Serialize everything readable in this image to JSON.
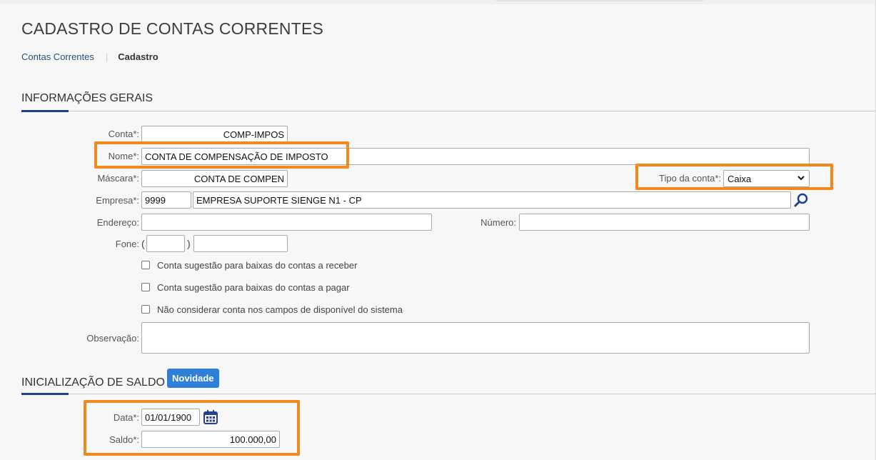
{
  "page": {
    "title": "CADASTRO DE CONTAS CORRENTES"
  },
  "breadcrumb": {
    "link": "Contas Correntes",
    "current": "Cadastro"
  },
  "sections": {
    "general": "INFORMAÇÕES GERAIS",
    "balance": "INICIALIZAÇÃO DE SALDO",
    "badge": "Novidade"
  },
  "form": {
    "conta": {
      "label": "Conta*:",
      "value": "COMP-IMPOS"
    },
    "nome": {
      "label": "Nome*:",
      "value": "CONTA DE COMPENSAÇÃO DE IMPOSTO"
    },
    "mascara": {
      "label": "Máscara*:",
      "value": "CONTA DE COMPEN"
    },
    "tipo": {
      "label": "Tipo da conta*:",
      "value": "Caixa"
    },
    "empresa": {
      "label": "Empresa*:",
      "code": "9999",
      "name": "EMPRESA SUPORTE SIENGE N1 - CP"
    },
    "endereco": {
      "label": "Endereço:",
      "value": ""
    },
    "numero": {
      "label": "Número:",
      "value": ""
    },
    "fone": {
      "label": "Fone:",
      "open": "(",
      "close": ")",
      "ddd": "",
      "number": ""
    },
    "checkboxes": [
      "Conta sugestão para baixas do contas a receber",
      "Conta sugestão para baixas do contas a pagar",
      "Não considerar conta nos campos de disponível do sistema"
    ],
    "observacao": {
      "label": "Observação:",
      "value": ""
    }
  },
  "saldo": {
    "data": {
      "label": "Data*:",
      "value": "01/01/1900"
    },
    "saldo": {
      "label": "Saldo*:",
      "value": "100.000,00"
    }
  },
  "icons": {
    "search": "search-icon",
    "calendar": "calendar-icon",
    "dropdown": "chevron-down-icon"
  },
  "colors": {
    "accent": "#1f3f8f",
    "highlight": "#f08a1c",
    "badge": "#2f7ed8"
  }
}
